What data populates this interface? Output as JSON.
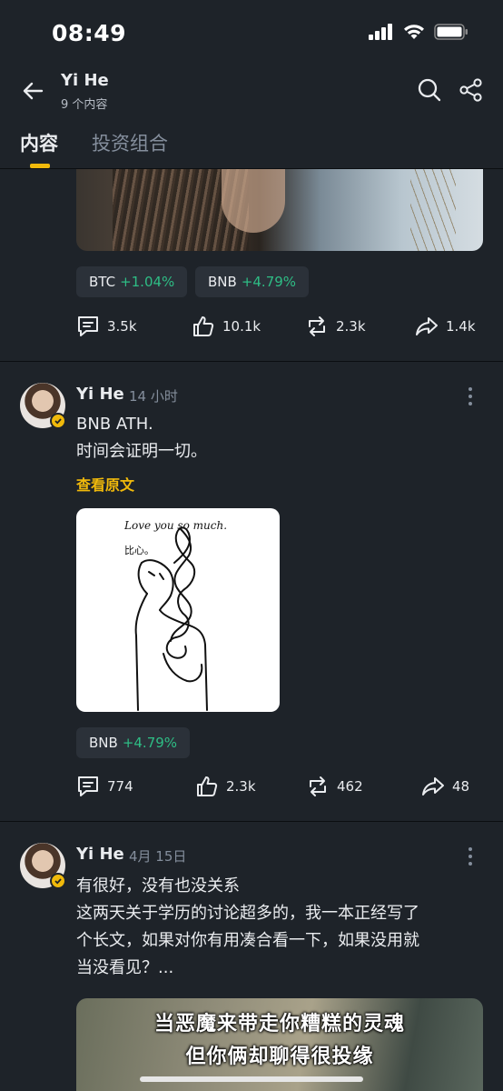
{
  "status_bar": {
    "time": "08:49"
  },
  "header": {
    "title": "Yi He",
    "subtitle": "9 个内容"
  },
  "tabs": [
    {
      "label": "内容",
      "active": true
    },
    {
      "label": "投资组合",
      "active": false
    }
  ],
  "colors": {
    "accent": "#f0b90b",
    "positive": "#2ebd85",
    "background": "#1e2329"
  },
  "posts": [
    {
      "tags": [
        {
          "symbol": "BTC",
          "change": "+1.04%"
        },
        {
          "symbol": "BNB",
          "change": "+4.79%"
        }
      ],
      "stats": {
        "comments": "3.5k",
        "likes": "10.1k",
        "reposts": "2.3k",
        "shares": "1.4k"
      }
    },
    {
      "author": "Yi He",
      "time": "14 小时",
      "text_line1": "BNB ATH.",
      "text_line2": "时间会证明一切。",
      "view_original": "查看原文",
      "image": {
        "caption": "Love you so much.",
        "subcaption": "比心。"
      },
      "tags": [
        {
          "symbol": "BNB",
          "change": "+4.79%"
        }
      ],
      "stats": {
        "comments": "774",
        "likes": "2.3k",
        "reposts": "462",
        "shares": "48"
      }
    },
    {
      "author": "Yi He",
      "time": "4月 15日",
      "text_line1": "有很好，没有也没关系",
      "text_line2": "这两天关于学历的讨论超多的，我一本正经写了",
      "text_line3": "个长文，如果对你有用凑合看一下，如果没用就",
      "text_line4": "当没看见？...",
      "image": {
        "line1": "当恶魔来带走你糟糕的灵魂",
        "line2": "但你俩却聊得很投缘"
      }
    }
  ]
}
